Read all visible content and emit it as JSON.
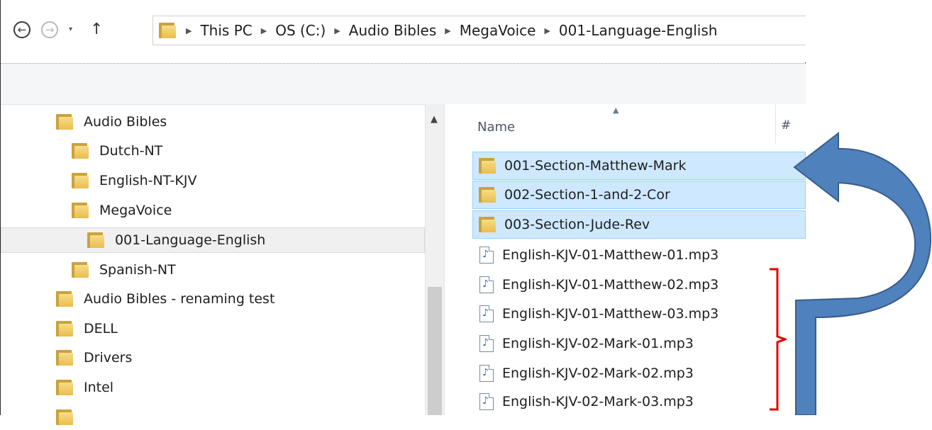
{
  "window": {
    "address_bar": {
      "crumbs": [
        "This PC",
        "OS (C:)",
        "Audio Bibles",
        "MegaVoice",
        "001-Language-English"
      ]
    },
    "nav_buttons": {
      "back": "←",
      "forward": "→",
      "recent": "▾",
      "up": "↑"
    }
  },
  "nav_pane": {
    "items": [
      {
        "label": "Audio Bibles",
        "level": 1
      },
      {
        "label": "Dutch-NT",
        "level": 2
      },
      {
        "label": "English-NT-KJV",
        "level": 2
      },
      {
        "label": "MegaVoice",
        "level": 2
      },
      {
        "label": "001-Language-English",
        "level": 3,
        "selected": true
      },
      {
        "label": "Spanish-NT",
        "level": 2
      },
      {
        "label": "Audio Bibles - renaming test",
        "level": 1
      },
      {
        "label": "DELL",
        "level": 1
      },
      {
        "label": "Drivers",
        "level": 1
      },
      {
        "label": "Intel",
        "level": 1
      }
    ]
  },
  "file_list": {
    "columns": {
      "name": "Name",
      "number": "#"
    },
    "items": [
      {
        "name": "001-Section-Matthew-Mark",
        "type": "folder",
        "selected": true
      },
      {
        "name": "002-Section-1-and-2-Cor",
        "type": "folder",
        "selected": true
      },
      {
        "name": "003-Section-Jude-Rev",
        "type": "folder",
        "selected": true
      },
      {
        "name": "English-KJV-01-Matthew-01.mp3",
        "type": "mp3"
      },
      {
        "name": "English-KJV-01-Matthew-02.mp3",
        "type": "mp3"
      },
      {
        "name": "English-KJV-01-Matthew-03.mp3",
        "type": "mp3"
      },
      {
        "name": "English-KJV-02-Mark-01.mp3",
        "type": "mp3"
      },
      {
        "name": "English-KJV-02-Mark-02.mp3",
        "type": "mp3"
      },
      {
        "name": "English-KJV-02-Mark-03.mp3",
        "type": "mp3"
      }
    ]
  },
  "colors": {
    "selection_fill": "#cde8ff",
    "selection_border": "#99d1ff",
    "annotation_arrow": "#4f81bd",
    "annotation_bracket": "#e00000",
    "folder_yellow": "#f3cd63"
  }
}
